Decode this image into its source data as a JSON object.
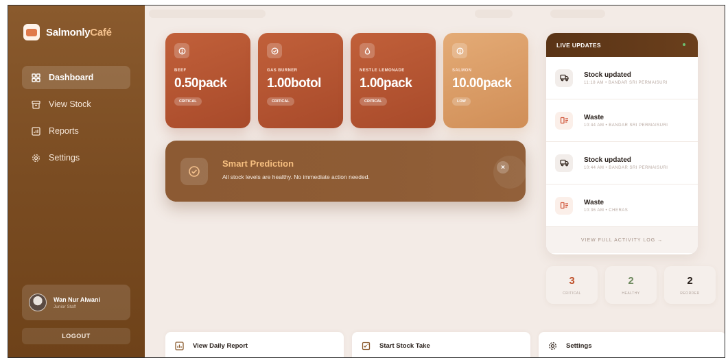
{
  "brand": {
    "name": "Salmonly",
    "accent": "Café"
  },
  "nav": [
    {
      "label": "Dashboard",
      "icon": "dashboard-grid-icon",
      "active": true
    },
    {
      "label": "View Stock",
      "icon": "inventory-box-icon",
      "active": false
    },
    {
      "label": "Reports",
      "icon": "chart-icon",
      "active": false
    },
    {
      "label": "Settings",
      "icon": "gear-icon",
      "active": false
    }
  ],
  "user": {
    "name": "Wan Nur Alwani",
    "role": "Junior Staff"
  },
  "logout_label": "LOGOUT",
  "stock_cards": [
    {
      "name": "BEEF",
      "value": "0.50pack",
      "status": "CRITICAL",
      "icon": "alert-circle-icon",
      "color": "#b3532f"
    },
    {
      "name": "GAS BURNER",
      "value": "1.00botol",
      "status": "CRITICAL",
      "icon": "check-circle-icon",
      "color": "#b3532f"
    },
    {
      "name": "NESTLE LEMONADE",
      "value": "1.00pack",
      "status": "CRITICAL",
      "icon": "droplet-icon",
      "color": "#b3532f"
    },
    {
      "name": "SALMON",
      "value": "10.00pack",
      "status": "LOW",
      "icon": "alert-circle-icon",
      "color": "#d89a64"
    }
  ],
  "prediction": {
    "title": "Smart Prediction",
    "message": "All stock levels are healthy. No immediate action needed.",
    "close": "×"
  },
  "live_updates": {
    "title": "LIVE UPDATES",
    "items": [
      {
        "title": "Stock updated",
        "meta": "11:18 AM • BANDAR SRI PERMAISURI",
        "icon": "truck-icon"
      },
      {
        "title": "Waste",
        "meta": "10:44 AM • BANDAR SRI PERMAISURI",
        "icon": "waste-icon"
      },
      {
        "title": "Stock updated",
        "meta": "10:44 AM • BANDAR SRI PERMAISURI",
        "icon": "truck-icon"
      },
      {
        "title": "Waste",
        "meta": "10:36 AM • CHERAS",
        "icon": "waste-icon"
      }
    ],
    "footer": "VIEW FULL ACTIVITY LOG →"
  },
  "counters": [
    {
      "value": "3",
      "label": "CRITICAL",
      "color": "#c0532d"
    },
    {
      "value": "2",
      "label": "HEALTHY",
      "color": "#6f8a5f"
    },
    {
      "value": "2",
      "label": "REORDER",
      "color": "#2a211c"
    }
  ],
  "actions": [
    {
      "label": "View Daily Report",
      "icon": "report-chart-icon"
    },
    {
      "label": "Start Stock Take",
      "icon": "clipboard-icon"
    },
    {
      "label": "Settings",
      "icon": "gear-icon"
    }
  ],
  "colors": {
    "sidebar": "#7a4c22",
    "critical": "#b3532f",
    "low": "#d89a64",
    "background": "#f3ebe6"
  }
}
